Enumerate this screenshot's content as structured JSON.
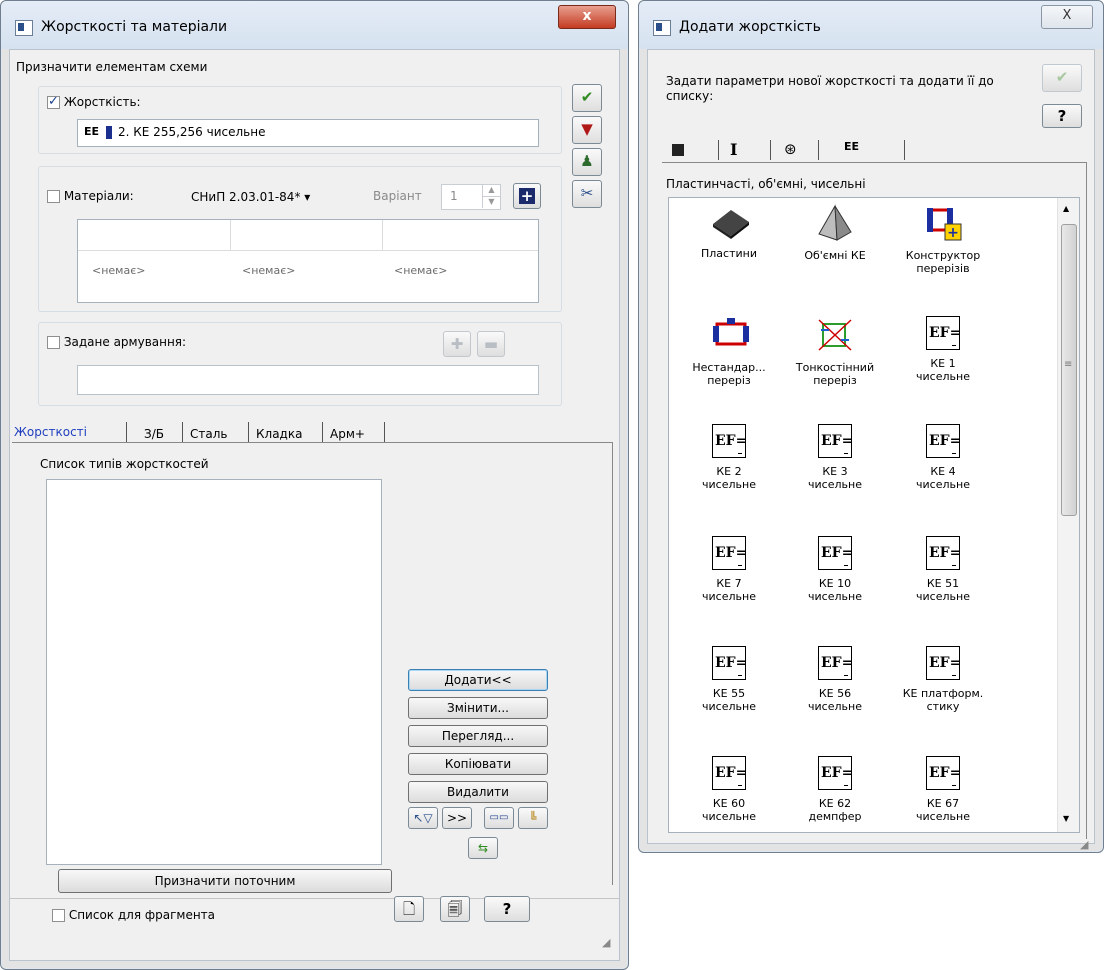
{
  "left_window": {
    "title": "Жорсткості та матеріали",
    "close": "x",
    "assign_heading": "Призначити елементам схеми",
    "stiffness": {
      "label": "Жорсткість:",
      "checked": true,
      "icon_text": "EE",
      "value": "2. КЕ 255,256 чисельне"
    },
    "materials": {
      "label": "Матеріали:",
      "checked": false,
      "standard": "СНиП 2.03.01-84*",
      "variant_label": "Варіант",
      "variant_value": "1",
      "cells": [
        "<немає>",
        "<немає>",
        "<немає>"
      ]
    },
    "reinforcement": {
      "label": "Задане армування:",
      "checked": false
    },
    "tabs": [
      "Жорсткості",
      "З/Б",
      "Сталь",
      "Кладка",
      "Арм+"
    ],
    "list_title": "Список типів жорсткостей",
    "buttons": {
      "add": "Додати<<",
      "change": "Змінити...",
      "view": "Перегляд...",
      "copy": "Копіювати",
      "delete": "Видалити",
      "assign_current": "Призначити поточним"
    },
    "fragment_label": "Список для фрагмента",
    "help": "?"
  },
  "right_window": {
    "title": "Додати жорсткість",
    "close": "X",
    "description": "Задати параметри нової жорсткості та додати її до списку:",
    "help": "?",
    "category_tabs": [
      "I",
      "EE"
    ],
    "section_title": "Пластинчасті, об'ємні, чисельні",
    "items": [
      {
        "label": "Пластини",
        "icon": "plate-icon"
      },
      {
        "label": "Об'ємні КЕ",
        "icon": "volume-icon"
      },
      {
        "label": "Конструктор\nперерізів",
        "icon": "section-constructor-icon"
      },
      {
        "label": "Нестандар...\nпереріз",
        "icon": "nonstandard-section-icon"
      },
      {
        "label": "Тонкостінний\nпереріз",
        "icon": "thin-wall-section-icon"
      },
      {
        "label": "КЕ 1\nчисельне",
        "icon": "ef-icon"
      },
      {
        "label": "КЕ 2\nчисельне",
        "icon": "ef-icon"
      },
      {
        "label": "КЕ 3\nчисельне",
        "icon": "ef-icon"
      },
      {
        "label": "КЕ 4\nчисельне",
        "icon": "ef-icon"
      },
      {
        "label": "КЕ 7\nчисельне",
        "icon": "ef-icon"
      },
      {
        "label": "КЕ 10\nчисельне",
        "icon": "ef-icon"
      },
      {
        "label": "КЕ 51\nчисельне",
        "icon": "ef-icon"
      },
      {
        "label": "КЕ 55\nчисельне",
        "icon": "ef-icon"
      },
      {
        "label": "КЕ 56\nчисельне",
        "icon": "ef-icon"
      },
      {
        "label": "КЕ платформ.\nстику",
        "icon": "ef-icon"
      },
      {
        "label": "КЕ 60\nчисельне",
        "icon": "ef-icon"
      },
      {
        "label": "КЕ 62\nдемпфер",
        "icon": "ef-icon"
      },
      {
        "label": "КЕ 67\nчисельне",
        "icon": "ef-icon"
      }
    ],
    "ef_icon_text": "EF=",
    "scrollbar_grip": "≡"
  }
}
